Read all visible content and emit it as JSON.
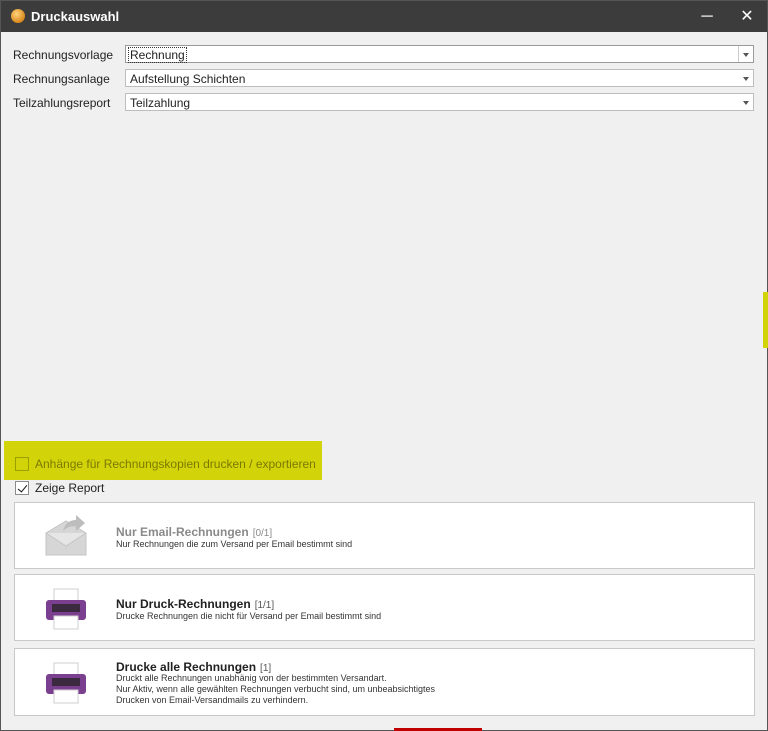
{
  "window": {
    "title": "Druckauswahl",
    "minimize_glyph": "─",
    "close_glyph": "✕",
    "icon": "app-logo-icon"
  },
  "form": {
    "rows": [
      {
        "label": "Rechnungsvorlage",
        "value": "Rechnung",
        "focused": true
      },
      {
        "label": "Rechnungsanlage",
        "value": "Aufstellung Schichten",
        "focused": false
      },
      {
        "label": "Teilzahlungsreport",
        "value": "Teilzahlung",
        "focused": false
      }
    ]
  },
  "options": {
    "attachments_label": "Anhänge für Rechnungskopien drucken / exportieren",
    "attachments_checked": false,
    "show_report_label": "Zeige Report",
    "show_report_checked": true
  },
  "actions": [
    {
      "title": "Nur Email-Rechnungen",
      "count": "[0/1]",
      "desc": [
        "Nur Rechnungen die zum Versand per Email bestimmt sind"
      ],
      "icon": "email-send-icon",
      "enabled": false
    },
    {
      "title": "Nur Druck-Rechnungen",
      "count": "[1/1]",
      "desc": [
        "Drucke Rechnungen die nicht für Versand per Email bestimmt sind"
      ],
      "icon": "printer-icon",
      "enabled": true
    },
    {
      "title": "Drucke alle Rechnungen",
      "count": "[1]",
      "desc": [
        "Druckt alle Rechnungen unabhänig von der bestimmten Versandart.",
        "Nur Aktiv, wenn alle gewählten Rechnungen verbucht sind, um unbeabsichtigtes",
        "Drucken von Email-Versandmails zu verhindern."
      ],
      "icon": "printer-icon",
      "enabled": true
    }
  ],
  "colors": {
    "titlebar": "#3c3c3c",
    "highlight": "#d3d30a",
    "printer_purple": "#7b3f8f"
  }
}
